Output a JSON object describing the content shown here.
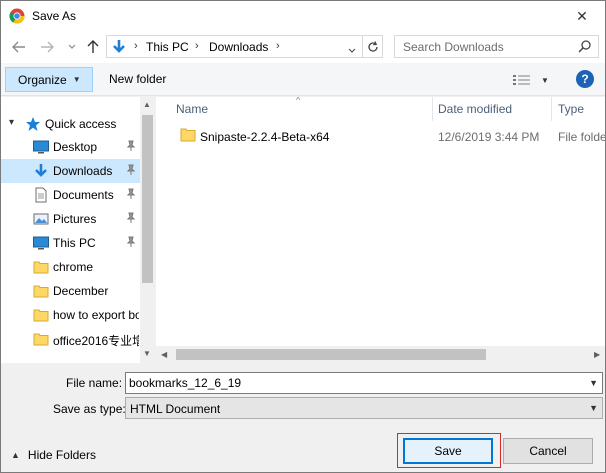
{
  "window": {
    "title": "Save As",
    "app_icon": "chrome-icon",
    "close_glyph": "✕"
  },
  "address_bar": {
    "crumbs": [
      "This PC",
      "Downloads"
    ],
    "separator": "›",
    "search_placeholder": "Search Downloads"
  },
  "command_bar": {
    "organize_label": "Organize",
    "new_folder_label": "New folder",
    "help_label": "?"
  },
  "navigation": {
    "quick_access_label": "Quick access",
    "items": [
      {
        "label": "Desktop",
        "icon": "desktop-icon",
        "pinned": true
      },
      {
        "label": "Downloads",
        "icon": "downloads-icon",
        "pinned": true,
        "selected": true
      },
      {
        "label": "Documents",
        "icon": "documents-icon",
        "pinned": true
      },
      {
        "label": "Pictures",
        "icon": "pictures-icon",
        "pinned": true
      },
      {
        "label": "This PC",
        "icon": "this-pc-icon",
        "pinned": true
      },
      {
        "label": "chrome",
        "icon": "folder-icon",
        "pinned": false
      },
      {
        "label": "December",
        "icon": "folder-icon",
        "pinned": false
      },
      {
        "label": "how to export bo",
        "icon": "folder-icon",
        "pinned": false
      },
      {
        "label": "office2016专业增",
        "icon": "folder-icon",
        "pinned": false
      }
    ]
  },
  "file_list": {
    "columns": [
      "Name",
      "Date modified",
      "Type"
    ],
    "rows": [
      {
        "name": "Snipaste-2.2.4-Beta-x64",
        "date": "12/6/2019 3:44 PM",
        "type": "File folde"
      }
    ]
  },
  "save_fields": {
    "file_name_label": "File name:",
    "file_name_value": "bookmarks_12_6_19",
    "save_type_label": "Save as type:",
    "save_type_value": "HTML Document"
  },
  "footer": {
    "hide_folders_label": "Hide Folders",
    "save_label": "Save",
    "cancel_label": "Cancel"
  },
  "colors": {
    "selection": "#cce8ff",
    "accent": "#0078d7",
    "highlight_outline": "#d62a2a",
    "folder": "#ffd766"
  }
}
